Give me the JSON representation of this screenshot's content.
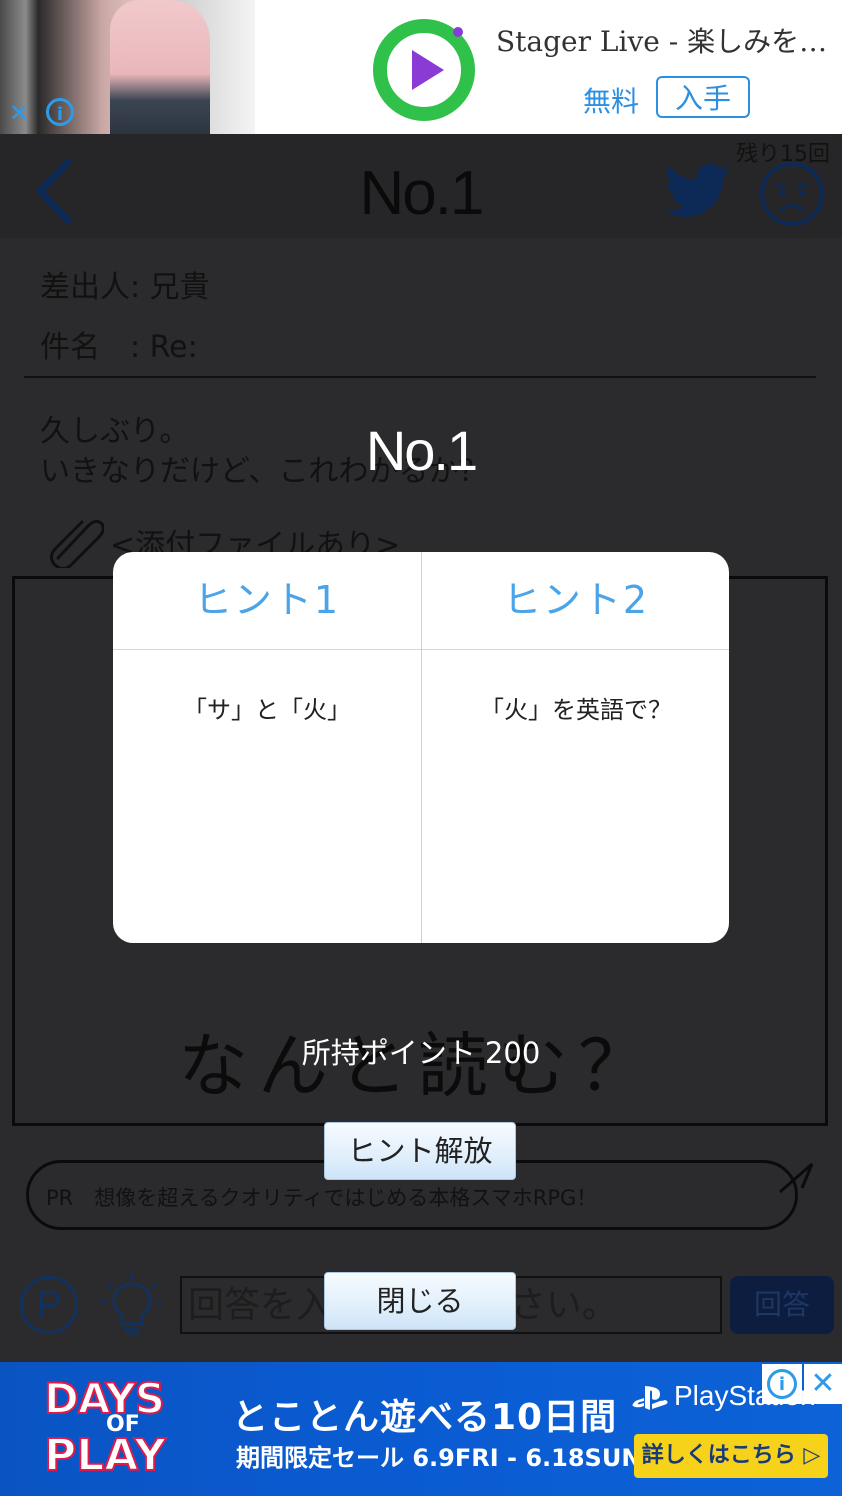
{
  "top_ad": {
    "title": "Stager Live - 楽しみを…",
    "free_label": "無料",
    "get_label": "入手",
    "close_glyph": "✕",
    "info_glyph": "i",
    "accent": "#2c9be8",
    "app_icon_color": "#2fc14a"
  },
  "header": {
    "title": "No.1",
    "remaining": "残り15回",
    "back_icon": "chevron-left-icon",
    "share_icon": "twitter-icon",
    "status_icon": "worried-face-icon"
  },
  "mail": {
    "sender": "差出人: 兄貴",
    "subject": "件名　: Re:",
    "body_line1": "久しぶり。",
    "body_line2": "いきなりだけど、これわかるか？",
    "attachment": "<添付ファイルあり>",
    "image_text": "なんと読む？"
  },
  "pr": {
    "text": "PR　想像を超えるクオリティではじめる本格スマホRPG！"
  },
  "answer_bar": {
    "points_glyph": "P",
    "placeholder": "回答を入力してください。",
    "submit_label": "回答"
  },
  "modal": {
    "title": "No.1",
    "hints": [
      {
        "label": "ヒント1",
        "text": "「サ」と「火」"
      },
      {
        "label": "ヒント2",
        "text": "「火」を英語で？"
      }
    ],
    "points_text": "所持ポイント 200",
    "unlock_label": "ヒント解放",
    "close_label": "閉じる",
    "accent": "#4ba3e8"
  },
  "bottom_ad": {
    "logo_days": "DAYS",
    "logo_of": "OF",
    "logo_play": "PLAY",
    "headline": "とことん遊べる10日間",
    "subline": "期間限定セール 6.9FRI - 6.18SUN",
    "brand": "PlayStation",
    "cta": "詳しくはこちら ▷",
    "close_glyph": "✕",
    "info_glyph": "i",
    "bg_color": "#0a58cc",
    "cta_color": "#f7d21a"
  }
}
